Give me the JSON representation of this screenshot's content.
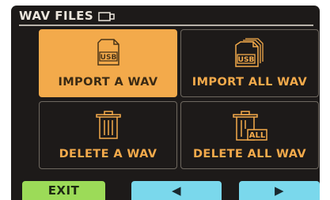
{
  "header": {
    "title": "WAV FILES",
    "icon": "memory-card-icon"
  },
  "tiles": [
    {
      "label": "IMPORT A WAV",
      "icon": "usb-file-icon",
      "selected": true
    },
    {
      "label": "IMPORT ALL WAV",
      "icon": "usb-files-stack-icon",
      "selected": false
    },
    {
      "label": "DELETE A WAV",
      "icon": "trash-icon",
      "selected": false
    },
    {
      "label": "DELETE ALL WAV",
      "icon": "trash-all-icon",
      "selected": false
    }
  ],
  "softkeys": {
    "exit_label": "EXIT",
    "prev_label": "◀",
    "next_label": "▶"
  },
  "icon_text": {
    "usb": "USB",
    "all": "ALL"
  },
  "colors": {
    "background": "#1d1a19",
    "accent_orange": "#f3aa4b",
    "exit_green": "#9cdb58",
    "nav_cyan": "#7ad8ec"
  }
}
